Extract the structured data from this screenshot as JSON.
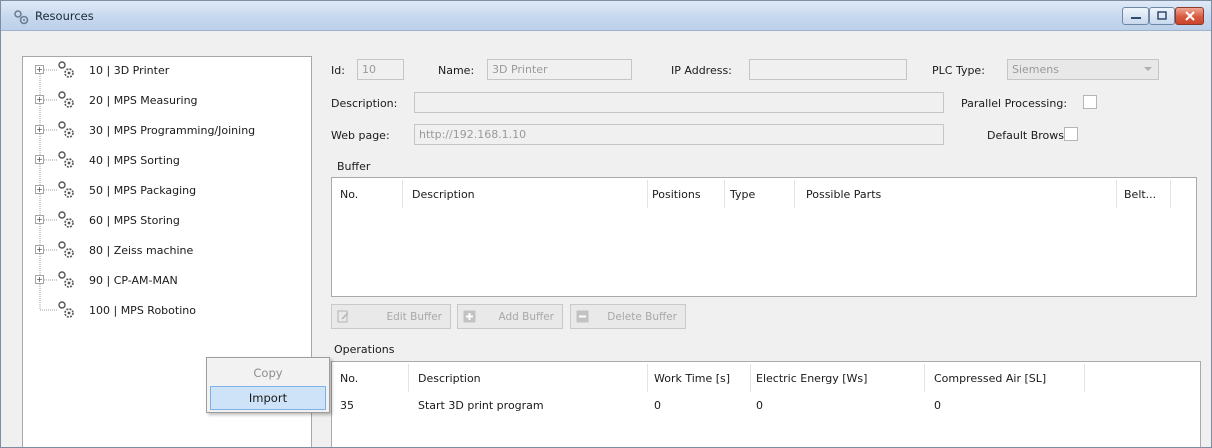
{
  "window": {
    "title": "Resources"
  },
  "tree": {
    "items": [
      {
        "label": "10 | 3D Printer",
        "expandable": true
      },
      {
        "label": "20 | MPS Measuring",
        "expandable": true
      },
      {
        "label": "30 | MPS Programming/Joining",
        "expandable": true
      },
      {
        "label": "40 | MPS Sorting",
        "expandable": true
      },
      {
        "label": "50 | MPS Packaging",
        "expandable": true
      },
      {
        "label": "60 | MPS Storing",
        "expandable": true
      },
      {
        "label": "80 | Zeiss machine",
        "expandable": true
      },
      {
        "label": "90 | CP-AM-MAN",
        "expandable": true
      },
      {
        "label": "100 | MPS Robotino",
        "expandable": false
      }
    ]
  },
  "context_menu": {
    "items": [
      "Copy",
      "Import"
    ]
  },
  "details": {
    "id_label": "Id:",
    "id_value": "10",
    "name_label": "Name:",
    "name_value": "3D Printer",
    "ip_label": "IP Address:",
    "ip_value": "",
    "plc_label": "PLC Type:",
    "plc_value": "Siemens",
    "description_label": "Description:",
    "description_value": "",
    "parallel_label": "Parallel Processing:",
    "webpage_label": "Web page:",
    "webpage_value": "http://192.168.1.10",
    "browser_label": "Default Browser:"
  },
  "buffer": {
    "section_label": "Buffer",
    "columns": [
      "No.",
      "Description",
      "Positions",
      "Type",
      "Possible Parts",
      "Belt..."
    ],
    "buttons": {
      "edit": "Edit Buffer",
      "add": "Add Buffer",
      "delete": "Delete Buffer"
    }
  },
  "operations": {
    "section_label": "Operations",
    "columns": [
      "No.",
      "Description",
      "Work Time [s]",
      "Electric Energy [Ws]",
      "Compressed Air [SL]"
    ],
    "rows": [
      {
        "no": "35",
        "description": "Start 3D print program",
        "work_time": "0",
        "energy": "0",
        "air": "0"
      }
    ]
  }
}
